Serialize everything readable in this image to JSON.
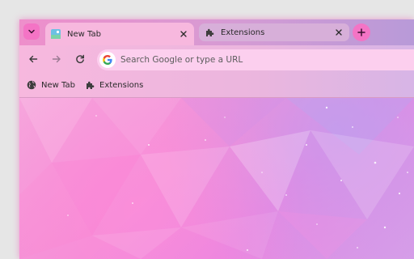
{
  "browser": {
    "tabs": [
      {
        "title": "New Tab",
        "favicon": "new-tab-thumbnail-icon",
        "active": true
      },
      {
        "title": "Extensions",
        "favicon": "puzzle-piece-icon",
        "active": false
      }
    ],
    "icons": {
      "tab_search": "chevron-down-icon",
      "new_tab": "plus-icon",
      "back": "arrow-left-icon",
      "forward": "arrow-right-icon",
      "reload": "reload-icon",
      "omnibox": "google-g-icon"
    }
  },
  "omnibox": {
    "placeholder": "Search Google or type a URL"
  },
  "bookmarks": [
    {
      "label": "New Tab",
      "icon": "globe-icon"
    },
    {
      "label": "Extensions",
      "icon": "puzzle-piece-icon"
    }
  ],
  "colors": {
    "accent": "#f474c5",
    "toolbar": "#f7b8de",
    "omnibox": "#fccfee"
  }
}
